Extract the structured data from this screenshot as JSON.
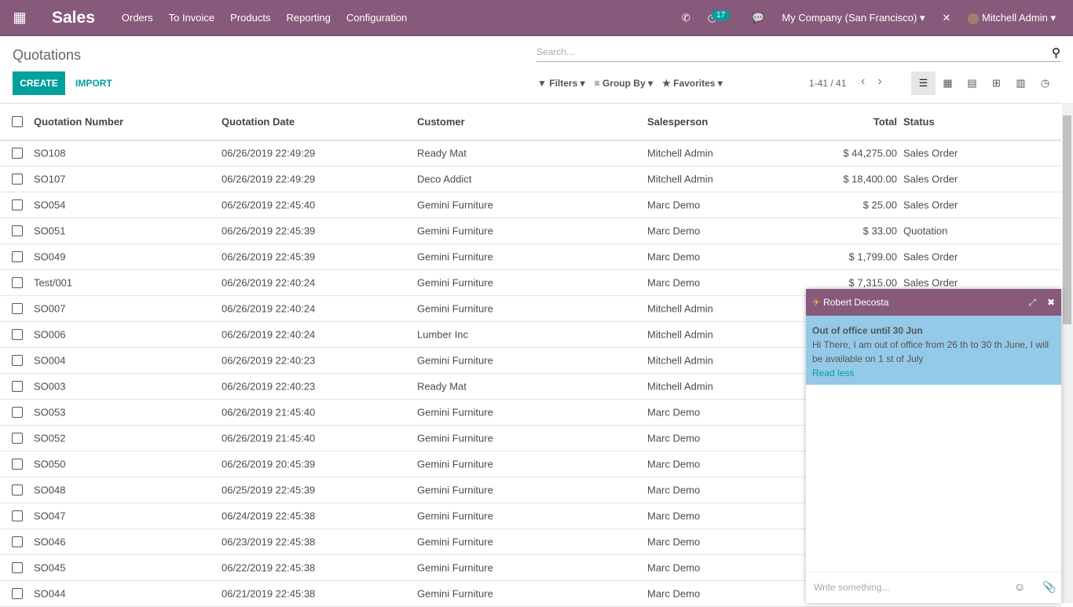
{
  "nav": {
    "app": "Sales",
    "menu": [
      "Orders",
      "To Invoice",
      "Products",
      "Reporting",
      "Configuration"
    ],
    "activity_count": "17",
    "company": "My Company (San Francisco)",
    "user": "Mitchell Admin"
  },
  "page": {
    "title": "Quotations",
    "search_placeholder": "Search...",
    "create": "CREATE",
    "import": "IMPORT",
    "filters": "Filters",
    "group_by": "Group By",
    "favorites": "Favorites",
    "pager": "1-41 / 41"
  },
  "table": {
    "headers": [
      "Quotation Number",
      "Quotation Date",
      "Customer",
      "Salesperson",
      "Total",
      "Status"
    ],
    "rows": [
      [
        "SO108",
        "06/26/2019 22:49:29",
        "Ready Mat",
        "Mitchell Admin",
        "$ 44,275.00",
        "Sales Order"
      ],
      [
        "SO107",
        "06/26/2019 22:49:29",
        "Deco Addict",
        "Mitchell Admin",
        "$ 18,400.00",
        "Sales Order"
      ],
      [
        "SO054",
        "06/26/2019 22:45:40",
        "Gemini Furniture",
        "Marc Demo",
        "$ 25.00",
        "Sales Order"
      ],
      [
        "SO051",
        "06/26/2019 22:45:39",
        "Gemini Furniture",
        "Marc Demo",
        "$ 33.00",
        "Quotation"
      ],
      [
        "SO049",
        "06/26/2019 22:45:39",
        "Gemini Furniture",
        "Marc Demo",
        "$ 1,799.00",
        "Sales Order"
      ],
      [
        "Test/001",
        "06/26/2019 22:40:24",
        "Gemini Furniture",
        "Marc Demo",
        "$ 7,315.00",
        "Sales Order"
      ],
      [
        "SO007",
        "06/26/2019 22:40:24",
        "Gemini Furniture",
        "Mitchell Admin",
        "",
        ""
      ],
      [
        "SO006",
        "06/26/2019 22:40:24",
        "Lumber Inc",
        "Mitchell Admin",
        "",
        ""
      ],
      [
        "SO004",
        "06/26/2019 22:40:23",
        "Gemini Furniture",
        "Mitchell Admin",
        "",
        ""
      ],
      [
        "SO003",
        "06/26/2019 22:40:23",
        "Ready Mat",
        "Mitchell Admin",
        "",
        ""
      ],
      [
        "SO053",
        "06/26/2019 21:45:40",
        "Gemini Furniture",
        "Marc Demo",
        "",
        ""
      ],
      [
        "SO052",
        "06/26/2019 21:45:40",
        "Gemini Furniture",
        "Marc Demo",
        "",
        ""
      ],
      [
        "SO050",
        "06/26/2019 20:45:39",
        "Gemini Furniture",
        "Marc Demo",
        "",
        ""
      ],
      [
        "SO048",
        "06/25/2019 22:45:39",
        "Gemini Furniture",
        "Marc Demo",
        "",
        ""
      ],
      [
        "SO047",
        "06/24/2019 22:45:38",
        "Gemini Furniture",
        "Marc Demo",
        "",
        ""
      ],
      [
        "SO046",
        "06/23/2019 22:45:38",
        "Gemini Furniture",
        "Marc Demo",
        "",
        ""
      ],
      [
        "SO045",
        "06/22/2019 22:45:38",
        "Gemini Furniture",
        "Marc Demo",
        "",
        ""
      ],
      [
        "SO044",
        "06/21/2019 22:45:38",
        "Gemini Furniture",
        "Marc Demo",
        "",
        ""
      ]
    ]
  },
  "chat": {
    "name": "Robert Decosta",
    "status_title": "Out of office until 30 Jun",
    "status_text": "Hi There, I am out of office from 26 th to 30 th June, I will be available on 1 st of July",
    "read_less": "Read less",
    "placeholder": "Write something..."
  },
  "colors": {
    "brand": "#875a7b",
    "accent": "#00a09d",
    "chat_message": "#94c9e8"
  }
}
